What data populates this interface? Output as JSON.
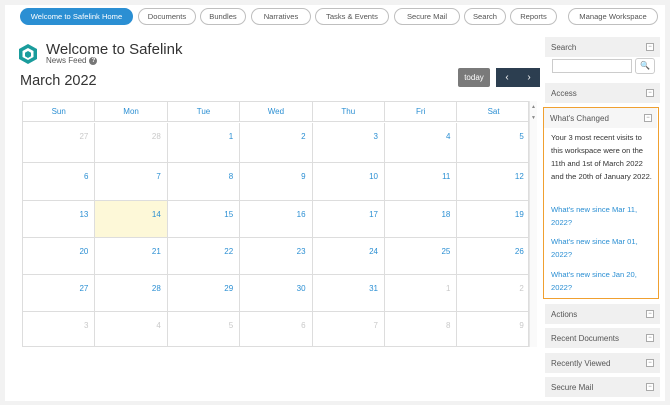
{
  "nav": {
    "tabs": [
      {
        "label": "Welcome to Safelink Home",
        "active": true
      },
      {
        "label": "Documents"
      },
      {
        "label": "Bundles"
      },
      {
        "label": "Narratives"
      },
      {
        "label": "Tasks & Events"
      },
      {
        "label": "Secure Mail"
      },
      {
        "label": "Search"
      },
      {
        "label": "Reports"
      }
    ],
    "manage_label": "Manage Workspace"
  },
  "header": {
    "title": "Welcome to Safelink",
    "subtitle": "News Feed",
    "help_glyph": "?"
  },
  "calendar": {
    "month": "March 2022",
    "today_label": "today",
    "prev_glyph": "‹",
    "next_glyph": "›",
    "weekdays": [
      "Sun",
      "Mon",
      "Tue",
      "Wed",
      "Thu",
      "Fri",
      "Sat"
    ],
    "weeks": [
      [
        "27",
        "28",
        "1",
        "2",
        "3",
        "4",
        "5"
      ],
      [
        "6",
        "7",
        "8",
        "9",
        "10",
        "11",
        "12"
      ],
      [
        "13",
        "14",
        "15",
        "16",
        "17",
        "18",
        "19"
      ],
      [
        "20",
        "21",
        "22",
        "23",
        "24",
        "25",
        "26"
      ],
      [
        "27",
        "28",
        "29",
        "30",
        "31",
        "1",
        "2"
      ],
      [
        "3",
        "4",
        "5",
        "6",
        "7",
        "8",
        "9"
      ]
    ],
    "today_date": "14"
  },
  "sidebar": {
    "search": {
      "label": "Search",
      "button_glyph": "🔍"
    },
    "access": {
      "label": "Access"
    },
    "whats_changed": {
      "label": "What's Changed",
      "message": "Your 3 most recent visits to this workspace were on the 11th and 1st of March 2022 and the 20th of January 2022.",
      "links": [
        "What's new since Mar 11, 2022?",
        "What's new since Mar 01, 2022?",
        "What's new since Jan 20, 2022?"
      ]
    },
    "sections": [
      "Actions",
      "Recent Documents",
      "Recently Viewed",
      "Secure Mail"
    ],
    "collapse_glyph": "−"
  },
  "colors": {
    "accent": "#2b8fd3",
    "nav_dark": "#2c3e50",
    "highlight_border": "#f0a030",
    "today_fill": "#fdf8d8"
  }
}
